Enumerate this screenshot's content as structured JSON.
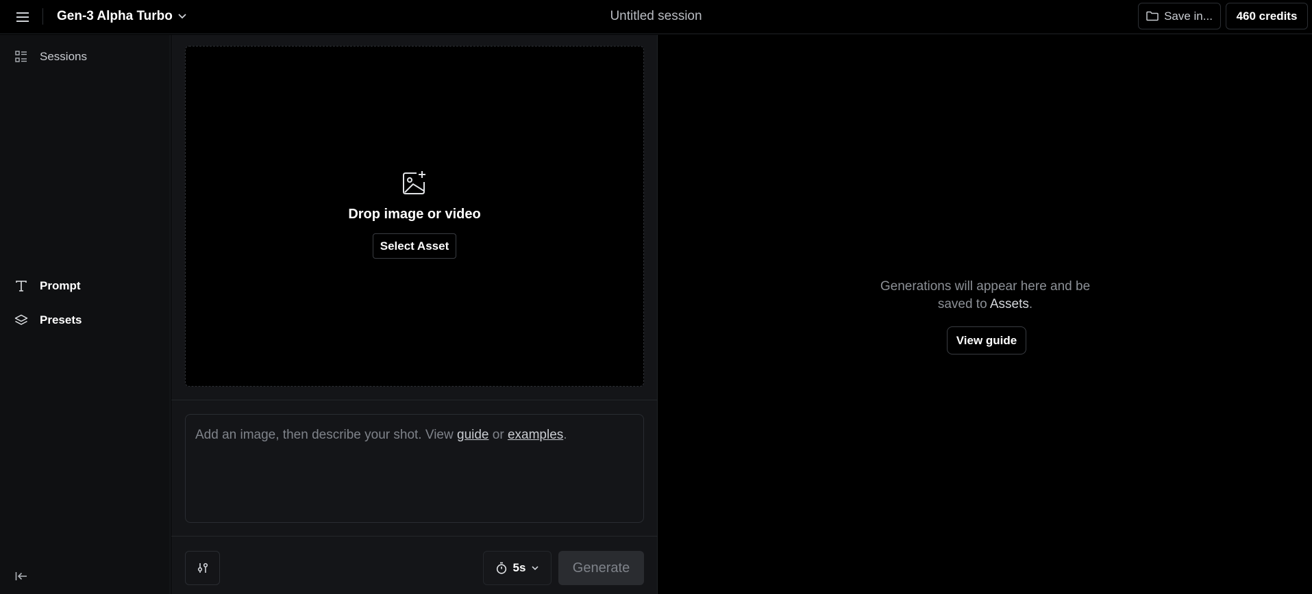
{
  "header": {
    "model_name": "Gen-3 Alpha Turbo",
    "session_title": "Untitled session",
    "save_label": "Save in...",
    "credits_label": "460 credits"
  },
  "sidebar": {
    "items": [
      {
        "label": "Sessions",
        "icon": "list-icon"
      },
      {
        "label": "Prompt",
        "icon": "text-icon"
      },
      {
        "label": "Presets",
        "icon": "layers-icon"
      }
    ]
  },
  "dropzone": {
    "title": "Drop image or video",
    "button_label": "Select Asset"
  },
  "prompt": {
    "text_before": "Add an image, then describe your shot. View ",
    "guide_link": "guide",
    "text_middle": " or ",
    "examples_link": "examples",
    "text_after": "."
  },
  "controls": {
    "duration_label": "5s",
    "generate_label": "Generate"
  },
  "output": {
    "message_line1": "Generations will appear here and be",
    "message_line2_prefix": "saved to ",
    "message_assets": "Assets",
    "message_line2_suffix": ".",
    "view_guide_label": "View guide"
  },
  "colors": {
    "background": "#000000",
    "panel": "#141518",
    "sidebar": "#0f1012",
    "border": "#2a2d32",
    "muted_text": "#7f838a"
  }
}
